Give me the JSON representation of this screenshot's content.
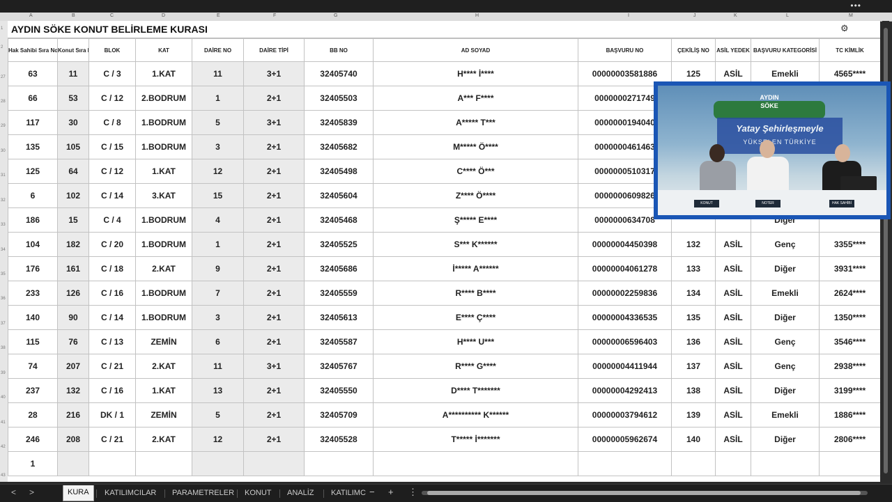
{
  "window": {
    "menu_dots": "•••"
  },
  "column_letters": [
    "A",
    "B",
    "C",
    "D",
    "E",
    "F",
    "G",
    "H",
    "I",
    "J",
    "K",
    "L",
    "M"
  ],
  "row_numbers": [
    "1",
    "2",
    "27",
    "28",
    "29",
    "30",
    "31",
    "32",
    "33",
    "34",
    "35",
    "36",
    "37",
    "38",
    "39",
    "40",
    "41",
    "42",
    "43"
  ],
  "sheet": {
    "title": "AYDIN SÖKE KONUT BELİRLEME KURASI",
    "title_icon": "settings-gear-icon"
  },
  "headers": [
    "Hak Sahibi Sıra No",
    "Konut Sıra No",
    "BLOK",
    "KAT",
    "DAİRE NO",
    "DAİRE TİPİ",
    "BB NO",
    "AD SOYAD",
    "BAŞVURU NO",
    "ÇEKİLİŞ NO",
    "ASİL YEDEK",
    "BAŞVURU KATEGORİSİ",
    "TC KİMLİK"
  ],
  "rows": [
    [
      "63",
      "11",
      "C / 3",
      "1.KAT",
      "11",
      "3+1",
      "32405740",
      "H**** İ****",
      "00000003581886",
      "125",
      "ASİL",
      "Emekli",
      "4565****"
    ],
    [
      "66",
      "53",
      "C / 12",
      "2.BODRUM",
      "1",
      "2+1",
      "32405503",
      "A*** F****",
      "0000000271749",
      "",
      "",
      "",
      ""
    ],
    [
      "117",
      "30",
      "C / 8",
      "1.BODRUM",
      "5",
      "3+1",
      "32405839",
      "A***** T***",
      "0000000194040",
      "",
      "",
      "",
      ""
    ],
    [
      "135",
      "105",
      "C / 15",
      "1.BODRUM",
      "3",
      "2+1",
      "32405682",
      "M***** Ö****",
      "0000000461463",
      "",
      "",
      "",
      ""
    ],
    [
      "125",
      "64",
      "C / 12",
      "1.KAT",
      "12",
      "2+1",
      "32405498",
      "C**** Ö***",
      "0000000510317",
      "",
      "",
      "",
      ""
    ],
    [
      "6",
      "102",
      "C / 14",
      "3.KAT",
      "15",
      "2+1",
      "32405604",
      "Z**** Ö****",
      "0000000609826",
      "",
      "",
      "",
      ""
    ],
    [
      "186",
      "15",
      "C / 4",
      "1.BODRUM",
      "4",
      "2+1",
      "32405468",
      "Ş***** E****",
      "0000000634708",
      "",
      "",
      "Diğer",
      ""
    ],
    [
      "104",
      "182",
      "C / 20",
      "1.BODRUM",
      "1",
      "2+1",
      "32405525",
      "S*** K******",
      "00000004450398",
      "132",
      "ASİL",
      "Genç",
      "3355****"
    ],
    [
      "176",
      "161",
      "C / 18",
      "2.KAT",
      "9",
      "2+1",
      "32405686",
      "İ***** A******",
      "00000004061278",
      "133",
      "ASİL",
      "Diğer",
      "3931****"
    ],
    [
      "233",
      "126",
      "C / 16",
      "1.BODRUM",
      "7",
      "2+1",
      "32405559",
      "R**** B****",
      "00000002259836",
      "134",
      "ASİL",
      "Emekli",
      "2624****"
    ],
    [
      "140",
      "90",
      "C / 14",
      "1.BODRUM",
      "3",
      "2+1",
      "32405613",
      "E**** Ç****",
      "00000004336535",
      "135",
      "ASİL",
      "Diğer",
      "1350****"
    ],
    [
      "115",
      "76",
      "C / 13",
      "ZEMİN",
      "6",
      "2+1",
      "32405587",
      "H**** U***",
      "00000006596403",
      "136",
      "ASİL",
      "Genç",
      "3546****"
    ],
    [
      "74",
      "207",
      "C / 21",
      "2.KAT",
      "11",
      "3+1",
      "32405767",
      "R**** G****",
      "00000004411944",
      "137",
      "ASİL",
      "Genç",
      "2938****"
    ],
    [
      "237",
      "132",
      "C / 16",
      "1.KAT",
      "13",
      "2+1",
      "32405550",
      "D**** T*******",
      "00000004292413",
      "138",
      "ASİL",
      "Diğer",
      "3199****"
    ],
    [
      "28",
      "216",
      "DK / 1",
      "ZEMİN",
      "5",
      "2+1",
      "32405709",
      "A********** K******",
      "00000003794612",
      "139",
      "ASİL",
      "Emekli",
      "1886****"
    ],
    [
      "246",
      "208",
      "C / 21",
      "2.KAT",
      "12",
      "2+1",
      "32405528",
      "T***** İ*******",
      "00000005962674",
      "140",
      "ASİL",
      "Diğer",
      "2806****"
    ],
    [
      "1",
      "",
      "",
      "",
      "",
      "",
      "",
      "",
      "",
      "",
      "",
      "",
      ""
    ]
  ],
  "overlay": {
    "city_line1": "AYDIN",
    "city_line2": "SÖKE",
    "slogan_line1": "Yatay Şehirleşmeyle",
    "slogan_line2": "YÜKSELEN TÜRKİYE",
    "nameplates": [
      "KONUT",
      "NOTER",
      "HAK SAHİBİ"
    ]
  },
  "tabs": [
    "KURA",
    "KATILIMCILAR",
    "PARAMETRELER",
    "KONUT",
    "ANALİZ",
    "KATILIMC"
  ],
  "tab_controls": {
    "prev": "<",
    "next": ">",
    "minus": "−",
    "add": "+",
    "more": "⋮"
  },
  "colors": {
    "asil_green": "#5cc43c",
    "overlay_border": "#1a56b5"
  }
}
